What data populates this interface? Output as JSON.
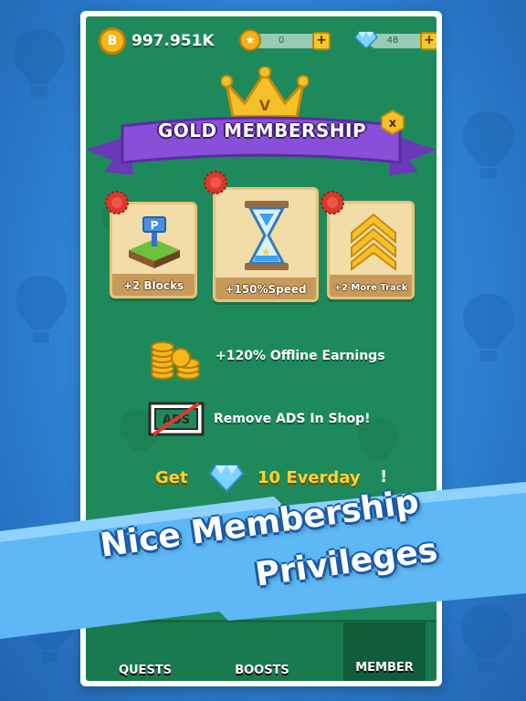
{
  "status": {
    "coins": "997.951K",
    "coin_icon_letter": "B",
    "stars": "0",
    "gems": "48",
    "plus": "+"
  },
  "membership": {
    "title": "GOLD MEMBERSHIP",
    "crown_letter": "V",
    "close": "x"
  },
  "cards": [
    {
      "label": "+2 Blocks"
    },
    {
      "label": "+150%Speed"
    },
    {
      "label": "+2 More Track"
    }
  ],
  "perks": {
    "offline": "+120% Offline Earnings",
    "ads": "Remove ADS In Shop!",
    "ads_icon_text": "ADS",
    "get_prefix": "Get",
    "get_suffix": "10 Everday",
    "get_exclaim": "!"
  },
  "tabs": {
    "quests": "QUESTS",
    "boosts": "BOOSTS",
    "member": "MEMBER"
  },
  "promo": {
    "line1": "Nice Membership",
    "line2": "Privileges"
  },
  "colors": {
    "background": "#2f86d6",
    "screen": "#1e8a5b",
    "banner": "#8a4fd8",
    "gold": "#f4b81c",
    "promo_band": "#5db8f5"
  }
}
